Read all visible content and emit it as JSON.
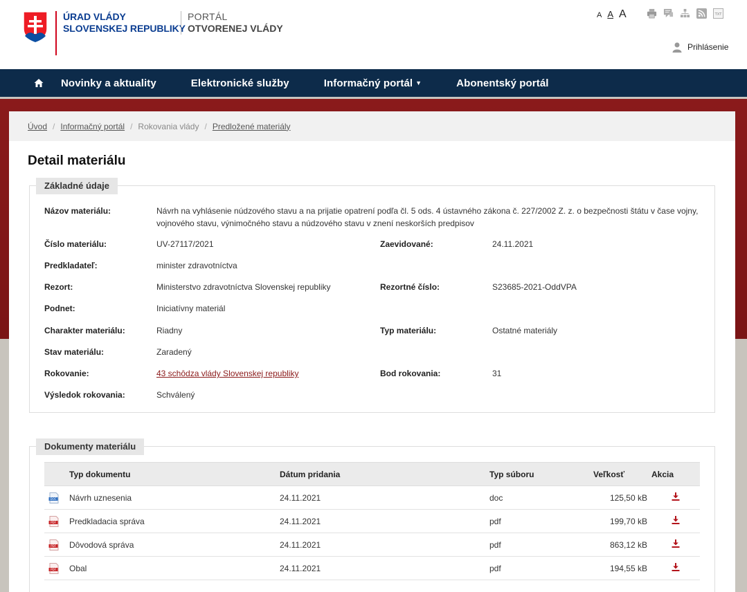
{
  "header": {
    "org_line1": "ÚRAD VLÁDY",
    "org_line2": "SLOVENSKEJ REPUBLIKY",
    "portal_line1": "PORTÁL",
    "portal_line2": "OTVORENEJ VLÁDY",
    "font_small": "A",
    "font_medium": "A",
    "font_large": "A",
    "tools": [
      "print-icon",
      "comment-icon",
      "sitemap-icon",
      "rss-icon",
      "txt-icon"
    ],
    "login_label": "Prihlásenie"
  },
  "nav": {
    "home_icon": "home-icon",
    "items": [
      {
        "label": "Novinky a aktuality"
      },
      {
        "label": "Elektronické služby"
      },
      {
        "label": "Informačný portál",
        "has_dropdown": true
      },
      {
        "label": "Abonentský portál"
      }
    ]
  },
  "breadcrumb": [
    "Úvod",
    "Informačný portál",
    "Rokovania vlády",
    "Predložené materiály"
  ],
  "page_title": "Detail materiálu",
  "basic": {
    "legend": "Základné údaje",
    "nazov_label": "Názov materiálu:",
    "nazov_value": "Návrh na vyhlásenie núdzového stavu a na prijatie opatrení podľa čl. 5 ods. 4 ústavného zákona č. 227/2002 Z. z. o bezpečnosti štátu v čase vojny, vojnového stavu, výnimočného stavu a núdzového stavu v znení neskorších predpisov",
    "cislo_label": "Číslo materiálu:",
    "cislo_value": "UV-27117/2021",
    "zaevidovane_label": "Zaevidované:",
    "zaevidovane_value": "24.11.2021",
    "predkladatel_label": "Predkladateľ:",
    "predkladatel_value": "minister zdravotníctva",
    "rezort_label": "Rezort:",
    "rezort_value": "Ministerstvo zdravotníctva Slovenskej republiky",
    "rezortne_label": "Rezortné číslo:",
    "rezortne_value": "S23685-2021-OddVPA",
    "podnet_label": "Podnet:",
    "podnet_value": "Iniciatívny materiál",
    "charakter_label": "Charakter materiálu:",
    "charakter_value": "Riadny",
    "typ_label": "Typ materiálu:",
    "typ_value": "Ostatné materiály",
    "stav_label": "Stav materiálu:",
    "stav_value": "Zaradený",
    "rokovanie_label": "Rokovanie:",
    "rokovanie_value": "43 schôdza vlády Slovenskej republiky",
    "bod_label": "Bod rokovania:",
    "bod_value": "31",
    "vysledok_label": "Výsledok rokovania:",
    "vysledok_value": "Schválený"
  },
  "docs": {
    "legend": "Dokumenty materiálu",
    "columns": [
      "Typ dokumentu",
      "Dátum pridania",
      "Typ súboru",
      "Veľkosť",
      "Akcia"
    ],
    "rows": [
      {
        "icon": "doc-file-icon",
        "type": "Návrh uznesenia",
        "date": "24.11.2021",
        "ftype": "doc",
        "size": "125,50 kB"
      },
      {
        "icon": "pdf-file-icon",
        "type": "Predkladacia správa",
        "date": "24.11.2021",
        "ftype": "pdf",
        "size": "199,70 kB"
      },
      {
        "icon": "pdf-file-icon",
        "type": "Dôvodová správa",
        "date": "24.11.2021",
        "ftype": "pdf",
        "size": "863,12 kB"
      },
      {
        "icon": "pdf-file-icon",
        "type": "Obal",
        "date": "24.11.2021",
        "ftype": "pdf",
        "size": "194,55 kB"
      }
    ]
  },
  "colors": {
    "nav_bg": "#0d2b4a",
    "brand_blue": "#0b3d91",
    "brand_red": "#d0021b",
    "link_red": "#8b1a1a",
    "band_red": "#8a1a1b",
    "band_stone": "#c8c4bd"
  }
}
